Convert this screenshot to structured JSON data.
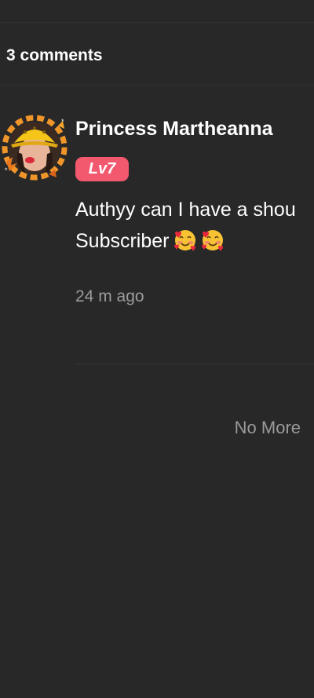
{
  "header": {
    "comment_count": "3 comments"
  },
  "comments": [
    {
      "username": "Princess Martheanna",
      "level": "Lv7",
      "text_line1": "Authyy can I have a shou",
      "text_line2": "Subscriber",
      "emojis": [
        "smiling-face-with-hearts-icon",
        "smiling-face-with-hearts-icon"
      ],
      "timestamp": "24 m ago"
    }
  ],
  "footer": {
    "no_more_label": "No More"
  },
  "colors": {
    "background": "#282828",
    "level_badge": "#f2586e",
    "muted_text": "#9a9a9a"
  }
}
